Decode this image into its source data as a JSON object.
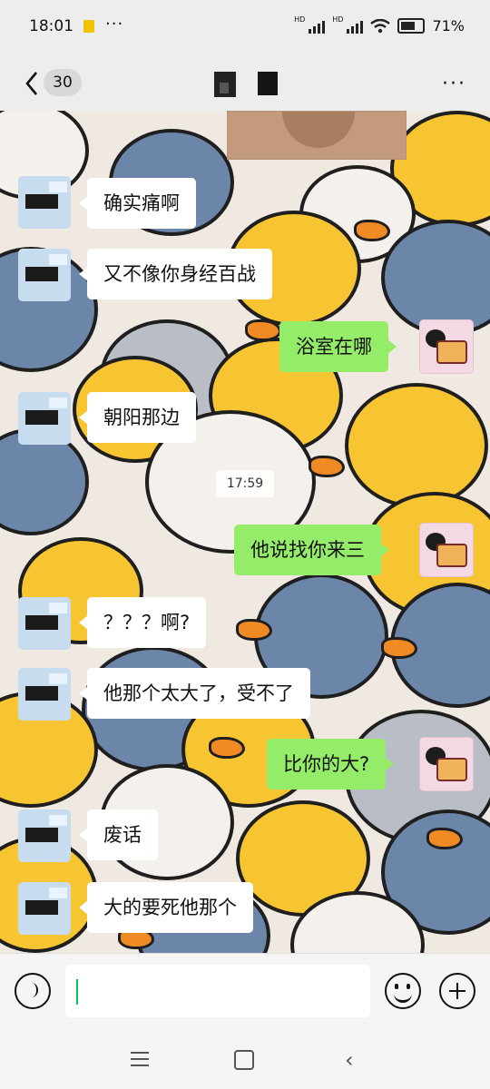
{
  "status": {
    "time": "18:01",
    "more": "···",
    "hd1": "HD",
    "hd2": "HD",
    "battery": "71%"
  },
  "header": {
    "unread_count": "30",
    "menu": "···"
  },
  "timestamp": "17:59",
  "messages": [
    {
      "side": "left",
      "text": "确实痛啊"
    },
    {
      "side": "left",
      "text": "又不像你身经百战"
    },
    {
      "side": "right",
      "text": "浴室在哪"
    },
    {
      "side": "left",
      "text": "朝阳那边"
    },
    {
      "side": "right",
      "text": "他说找你来三"
    },
    {
      "side": "left",
      "text": "？？？啊?"
    },
    {
      "side": "left",
      "text": "他那个太大了，受不了"
    },
    {
      "side": "right",
      "text": "比你的大?"
    },
    {
      "side": "left",
      "text": "废话"
    },
    {
      "side": "left",
      "text": "大的要死他那个"
    }
  ],
  "colors": {
    "background": "#ededed",
    "my_bubble": "#95ec69",
    "other_bubble": "#ffffff",
    "duck_yellow": "#f7c531",
    "duck_blue": "#6b86a8",
    "duck_gray": "#b9bec6",
    "duck_white": "#f4f1ec"
  },
  "icons": [
    "back-icon",
    "voice-icon",
    "emoji-icon",
    "plus-icon",
    "menu-icon",
    "home-icon",
    "nav-back-icon"
  ]
}
